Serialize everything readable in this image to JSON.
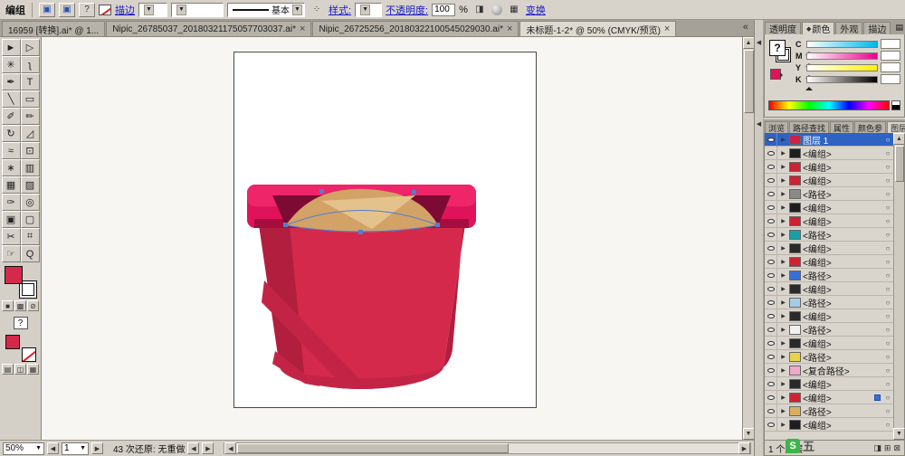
{
  "icons": {
    "close": "×",
    "expand": "▶",
    "target": "○",
    "panel_menu": "▤",
    "collapse_left": "◀",
    "arrow_up": "▲",
    "arrow_down": "▼",
    "arrow_left": "◀",
    "arrow_right": "▶",
    "combo": "▼",
    "dock": "«",
    "help": "?",
    "doc1": "▣",
    "doc2": "▣",
    "mask": "◨",
    "grid": "▦",
    "dots": "⁘",
    "new_layer": "⊞",
    "delete_layer": "⊠",
    "clip_mask": "◨",
    "color_btn": "■",
    "gradient_btn": "▩",
    "none_btn": "⊘",
    "screen_mode1": "▤",
    "screen_mode2": "◫",
    "screen_mode3": "▦"
  },
  "topbar": {
    "context_label": "编组",
    "stroke_link": "描边",
    "brush_style_value": "基本",
    "style_label": "样式:",
    "opacity_label": "不透明度:",
    "opacity_value": "100",
    "opacity_unit": "%",
    "transform_link": "变换"
  },
  "tabs": {
    "items": [
      {
        "label": "16959 [转换].ai* @ 1...",
        "closable": false,
        "active": false
      },
      {
        "label": "Nipic_26785037_20180321175057703037.ai*",
        "closable": true,
        "active": false
      },
      {
        "label": "Nipic_26725256_20180322100545029030.ai*",
        "closable": true,
        "active": false
      },
      {
        "label": "未标题-1-2* @ 50% (CMYK/预览)",
        "closable": true,
        "active": true
      }
    ]
  },
  "tools": {
    "items": [
      {
        "name": "selection-tool",
        "glyph": "►"
      },
      {
        "name": "direct-selection-tool",
        "glyph": "▷"
      },
      {
        "name": "magic-wand-tool",
        "glyph": "✳"
      },
      {
        "name": "lasso-tool",
        "glyph": "ʅ"
      },
      {
        "name": "pen-tool",
        "glyph": "✒"
      },
      {
        "name": "type-tool",
        "glyph": "T"
      },
      {
        "name": "line-segment-tool",
        "glyph": "╲"
      },
      {
        "name": "rectangle-tool",
        "glyph": "▭"
      },
      {
        "name": "paintbrush-tool",
        "glyph": "✐"
      },
      {
        "name": "pencil-tool",
        "glyph": "✏"
      },
      {
        "name": "rotate-tool",
        "glyph": "↻"
      },
      {
        "name": "scale-tool",
        "glyph": "◿"
      },
      {
        "name": "warp-tool",
        "glyph": "≈"
      },
      {
        "name": "free-transform-tool",
        "glyph": "⊡"
      },
      {
        "name": "symbol-sprayer-tool",
        "glyph": "∗"
      },
      {
        "name": "graph-tool",
        "glyph": "▥"
      },
      {
        "name": "mesh-tool",
        "glyph": "▦"
      },
      {
        "name": "gradient-tool",
        "glyph": "▨"
      },
      {
        "name": "eyedropper-tool",
        "glyph": "✑"
      },
      {
        "name": "blend-tool",
        "glyph": "◎"
      },
      {
        "name": "live-paint-bucket-tool",
        "glyph": "▣"
      },
      {
        "name": "live-paint-selection-tool",
        "glyph": "▢"
      },
      {
        "name": "scissors-tool",
        "glyph": "✂"
      },
      {
        "name": "slice-tool",
        "glyph": "⌗"
      },
      {
        "name": "hand-tool",
        "glyph": "☞"
      },
      {
        "name": "zoom-tool",
        "glyph": "Q"
      }
    ]
  },
  "statusbar": {
    "zoom_value": "50%",
    "page_value": "1",
    "status_text": "43 次还原: 无重做"
  },
  "right": {
    "top_tabs": {
      "items": [
        {
          "label": "透明度",
          "active": false
        },
        {
          "label": "颜色",
          "active": true,
          "marker": "◆"
        },
        {
          "label": "外观",
          "active": false
        },
        {
          "label": "描边",
          "active": false
        }
      ]
    },
    "color_panel": {
      "fill_unknown": "?",
      "channels": [
        {
          "label": "C",
          "value": ""
        },
        {
          "label": "M",
          "value": ""
        },
        {
          "label": "Y",
          "value": ""
        },
        {
          "label": "K",
          "value": ""
        }
      ]
    },
    "mid_tabs": {
      "items": [
        "浏览",
        "路径查找",
        "属性",
        "颜色参",
        "图层"
      ],
      "active": "图层"
    },
    "layers": {
      "rows": [
        {
          "name": "图层 1",
          "selected": true,
          "thumb": "#cc2244"
        },
        {
          "name": "<编组>",
          "thumb": "#1e1e1e"
        },
        {
          "name": "<编组>",
          "thumb": "#c23"
        },
        {
          "name": "<编组>",
          "thumb": "#c23"
        },
        {
          "name": "<路径>",
          "thumb": "#8a8a8a"
        },
        {
          "name": "<编组>",
          "thumb": "#1e1e1e"
        },
        {
          "name": "<编组>",
          "thumb": "#c23"
        },
        {
          "name": "<路径>",
          "thumb": "#18a0a8"
        },
        {
          "name": "<编组>",
          "thumb": "#2a2a2a"
        },
        {
          "name": "<编组>",
          "thumb": "#c23"
        },
        {
          "name": "<路径>",
          "thumb": "#3a6fd8"
        },
        {
          "name": "<编组>",
          "thumb": "#2a2a2a"
        },
        {
          "name": "<路径>",
          "thumb": "#a6cbe8"
        },
        {
          "name": "<编组>",
          "thumb": "#2a2a2a"
        },
        {
          "name": "<路径>",
          "thumb": "#f0f0f0"
        },
        {
          "name": "<编组>",
          "thumb": "#2a2a2a"
        },
        {
          "name": "<路径>",
          "thumb": "#e8d44a"
        },
        {
          "name": "<复合路径>",
          "thumb": "#f0a8c8"
        },
        {
          "name": "<编组>",
          "thumb": "#2a2a2a"
        },
        {
          "name": "<编组>",
          "thumb": "#c23",
          "dot": true
        },
        {
          "name": "<路径>",
          "thumb": "#d8b060"
        },
        {
          "name": "<编组>",
          "thumb": "#1e1e1e"
        }
      ],
      "footer": "1 个图层"
    }
  },
  "colors": {
    "bucket_rim": "#e0135a",
    "bucket_rim_top": "#ee2568",
    "bucket_rim_shadow": "#a50d3f",
    "bucket_opening": "#7d0a33",
    "bucket_body": "#d5294b",
    "bucket_body_dark": "#b21f3e",
    "bucket_body_stripe": "#c32446",
    "sand": "#d2a267",
    "sand_light": "#e4c28c",
    "selection": "#4f7fd0",
    "fill_swatch": "#d5294b"
  },
  "watermark": {
    "badge": "S",
    "text": "五"
  }
}
